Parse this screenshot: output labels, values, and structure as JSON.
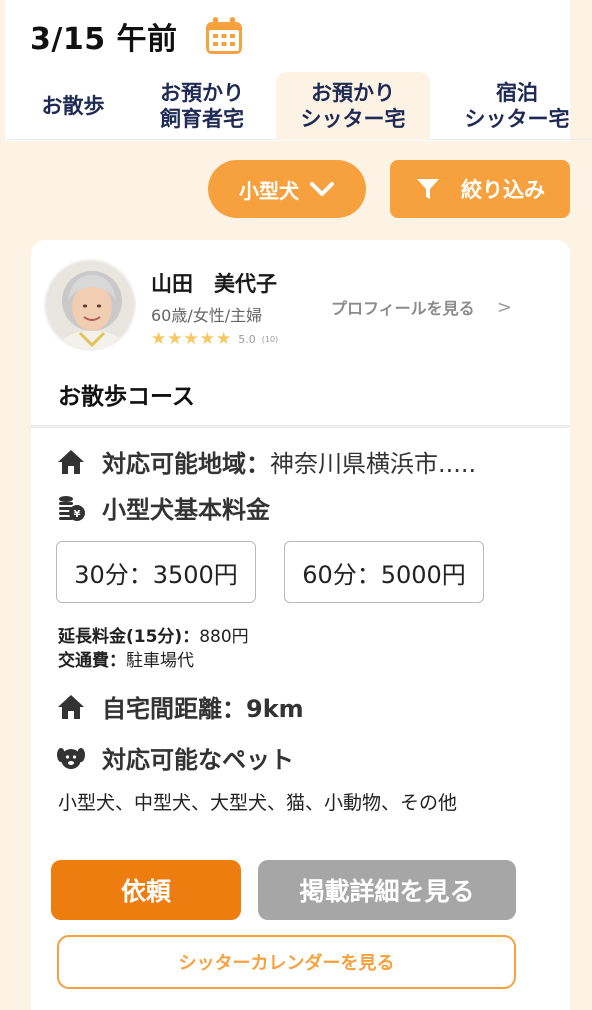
{
  "header": {
    "date_title": "3/15 午前",
    "calendar_icon": "calendar-icon"
  },
  "tabs": [
    {
      "label_line1": "お散歩",
      "label_line2": "",
      "active": false
    },
    {
      "label_line1": "お預かり",
      "label_line2": "飼育者宅",
      "active": false
    },
    {
      "label_line1": "お預かり",
      "label_line2": "シッター宅",
      "active": true
    },
    {
      "label_line1": "宿泊",
      "label_line2": "シッター宅",
      "active": false
    }
  ],
  "filters": {
    "dog_size_label": "小型犬",
    "filter_label": "絞り込み"
  },
  "colors": {
    "accent": "#f6a13d",
    "primary_button": "#ee7d10",
    "secondary_button": "#a6a6a6",
    "background": "#fdf3e5",
    "star": "#f6c85f"
  },
  "sitter": {
    "name": "山田　美代子",
    "meta": "60歳/女性/主婦",
    "rating": "5.0",
    "review_count": "(10)",
    "stars": 5,
    "profile_link": "プロフィールを見る",
    "profile_arrow": ">"
  },
  "course": {
    "title": "お散歩コース",
    "area_label": "対応可能地域：",
    "area_value": "神奈川県横浜市.....",
    "fee_label": "小型犬基本料金",
    "prices": [
      "30分：3500円",
      "60分：5000円"
    ],
    "extension_label": "延長料金(15分)：",
    "extension_value": "880円",
    "transport_label": "交通費：",
    "transport_value": "駐車場代",
    "distance_label": "自宅間距離：9km",
    "pets_label": "対応可能なペット",
    "pets_value": "小型犬、中型犬、大型犬、猫、小動物、その他"
  },
  "actions": {
    "request": "依頼",
    "detail": "掲載詳細を見る",
    "calendar": "シッターカレンダーを見る"
  }
}
